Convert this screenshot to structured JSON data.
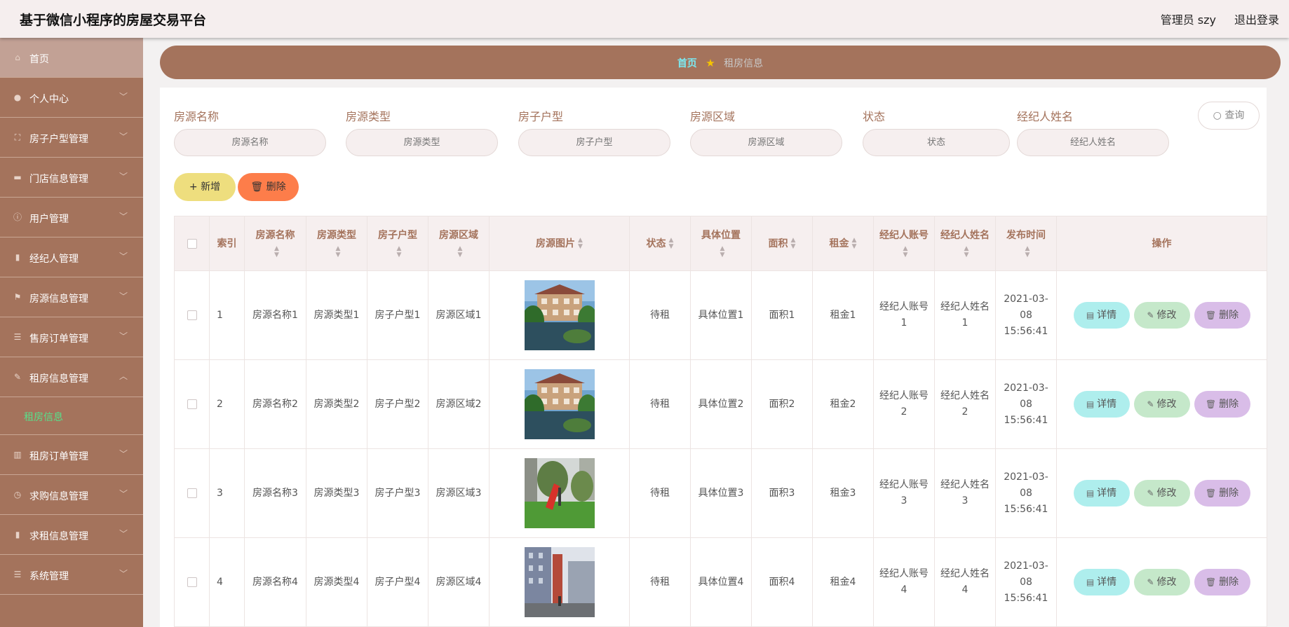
{
  "header": {
    "title": "基于微信小程序的房屋交易平台",
    "user": "管理员 szy",
    "logout": "退出登录"
  },
  "sidebar": {
    "items": [
      {
        "label": "首页",
        "icon": "home-icon"
      },
      {
        "label": "个人中心",
        "icon": "user-icon"
      },
      {
        "label": "房子户型管理",
        "icon": "frame-icon"
      },
      {
        "label": "门店信息管理",
        "icon": "monitor-icon"
      },
      {
        "label": "用户管理",
        "icon": "info-icon"
      },
      {
        "label": "经纪人管理",
        "icon": "clipboard-icon"
      },
      {
        "label": "房源信息管理",
        "icon": "flag-icon"
      },
      {
        "label": "售房订单管理",
        "icon": "menu-icon"
      },
      {
        "label": "租房信息管理",
        "icon": "edit-icon"
      },
      {
        "label": "租房订单管理",
        "icon": "chart-icon"
      },
      {
        "label": "求购信息管理",
        "icon": "compass-icon"
      },
      {
        "label": "求租信息管理",
        "icon": "clipboard-icon"
      },
      {
        "label": "系统管理",
        "icon": "menu-icon"
      }
    ],
    "submenu": "租房信息"
  },
  "breadcrumb": {
    "home": "首页",
    "current": "租房信息"
  },
  "filters": [
    {
      "label": "房源名称",
      "placeholder": "房源名称"
    },
    {
      "label": "房源类型",
      "placeholder": "房源类型"
    },
    {
      "label": "房子户型",
      "placeholder": "房子户型"
    },
    {
      "label": "房源区域",
      "placeholder": "房源区域"
    },
    {
      "label": "状态",
      "placeholder": "状态"
    },
    {
      "label": "经纪人姓名",
      "placeholder": "经纪人姓名"
    }
  ],
  "buttons": {
    "query": "查询",
    "add": "新增",
    "delete": "删除"
  },
  "table": {
    "headers": [
      "索引",
      "房源名称",
      "房源类型",
      "房子户型",
      "房源区域",
      "房源图片",
      "状态",
      "具体位置",
      "面积",
      "租金",
      "经纪人账号",
      "经纪人姓名",
      "发布时间",
      "操作"
    ],
    "rows": [
      {
        "index": "1",
        "name": "房源名称1",
        "type": "房源类型1",
        "layout": "房子户型1",
        "area": "房源区域1",
        "image": "villa-photo",
        "status": "待租",
        "location": "具体位置1",
        "size": "面积1",
        "rent": "租金1",
        "agent_account": "经纪人账号1",
        "agent_name": "经纪人姓名1",
        "time": "2021-03-08 15:56:41"
      },
      {
        "index": "2",
        "name": "房源名称2",
        "type": "房源类型2",
        "layout": "房子户型2",
        "area": "房源区域2",
        "image": "villa-photo",
        "status": "待租",
        "location": "具体位置2",
        "size": "面积2",
        "rent": "租金2",
        "agent_account": "经纪人账号2",
        "agent_name": "经纪人姓名2",
        "time": "2021-03-08 15:56:41"
      },
      {
        "index": "3",
        "name": "房源名称3",
        "type": "房源类型3",
        "layout": "房子户型3",
        "area": "房源区域3",
        "image": "playground-photo",
        "status": "待租",
        "location": "具体位置3",
        "size": "面积3",
        "rent": "租金3",
        "agent_account": "经纪人账号3",
        "agent_name": "经纪人姓名3",
        "time": "2021-03-08 15:56:41"
      },
      {
        "index": "4",
        "name": "房源名称4",
        "type": "房源类型4",
        "layout": "房子户型4",
        "area": "房源区域4",
        "image": "street-photo",
        "status": "待租",
        "location": "具体位置4",
        "size": "面积4",
        "rent": "租金4",
        "agent_account": "经纪人账号4",
        "agent_name": "经纪人姓名4",
        "time": "2021-03-08 15:56:41"
      }
    ],
    "actions": {
      "detail": "详情",
      "edit": "修改",
      "delete": "删除"
    }
  },
  "colors": {
    "brand": "#a4735c",
    "accent_green": "#58e08a",
    "crumb_home": "#7ce9f0"
  }
}
